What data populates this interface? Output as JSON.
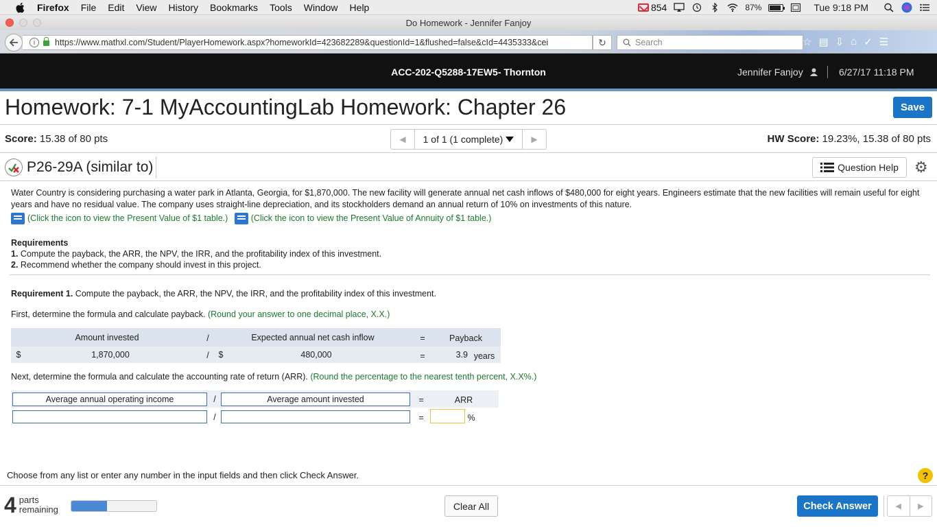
{
  "menubar": {
    "app": "Firefox",
    "items": [
      "File",
      "Edit",
      "View",
      "History",
      "Bookmarks",
      "Tools",
      "Window",
      "Help"
    ],
    "mail_count": "854",
    "battery": "87%",
    "clock": "Tue 9:18 PM"
  },
  "window": {
    "title": "Do Homework - Jennifer Fanjoy"
  },
  "browser": {
    "url": "https://www.mathxl.com/Student/PlayerHomework.aspx?homeworkId=423682289&questionId=1&flushed=false&cId=4435333&cei",
    "search_placeholder": "Search"
  },
  "course": {
    "name": "ACC-202-Q5288-17EW5- Thornton",
    "user": "Jennifer Fanjoy",
    "date": "6/27/17 11:18 PM"
  },
  "homework": {
    "title": "Homework: 7-1 MyAccountingLab Homework: Chapter 26",
    "save_label": "Save",
    "score_label": "Score:",
    "score_value": "15.38 of 80 pts",
    "pager_text": "1 of 1 (1 complete)",
    "hw_score_label": "HW Score:",
    "hw_score_value": "19.23%, 15.38 of 80 pts"
  },
  "question": {
    "title": "P26-29A (similar to)",
    "help_label": "Question Help",
    "problem_text": "Water Country is considering purchasing a water park in Atlanta, Georgia, for $1,870,000. The new facility will generate annual net cash inflows of $480,000 for eight years. Engineers estimate that the new facilities will remain useful for eight years and have no residual value. The company uses straight-line depreciation, and its stockholders demand an annual return of 10% on investments of this nature.",
    "link1": "(Click the icon to view the Present Value of $1 table.)",
    "link2": "(Click the icon to view the Present Value of Annuity of $1 table.)",
    "requirements_heading": "Requirements",
    "req1_num": "1.",
    "req1_text": "Compute the payback, the ARR, the NPV, the IRR, and the profitability index of this investment.",
    "req2_num": "2.",
    "req2_text": "Recommend whether the company should invest in this project.",
    "req1_heading": "Requirement 1.",
    "req1_heading_text": "Compute the payback, the ARR, the NPV, the IRR, and the profitability index of this investment.",
    "first_text": "First, determine the formula and calculate payback.",
    "first_hint": "(Round your answer to one decimal place, X.X.)",
    "next_text": "Next, determine the formula and calculate the accounting rate of return (ARR).",
    "next_hint": "(Round the percentage to the nearest tenth percent, X.X%.)"
  },
  "payback": {
    "h_amount": "Amount invested",
    "h_div": "/",
    "h_cash": "Expected annual net cash inflow",
    "h_eq": "=",
    "h_payback": "Payback",
    "dollar1": "$",
    "amount": "1,870,000",
    "div": "/",
    "dollar2": "$",
    "cash": "480,000",
    "eq": "=",
    "payback_value": "3.9",
    "unit": "years"
  },
  "arr": {
    "h_income": "Average annual operating income",
    "h_div": "/",
    "h_invested": "Average amount invested",
    "h_eq": "=",
    "h_arr": "ARR",
    "income_value": "",
    "div": "/",
    "invested_value": "",
    "eq": "=",
    "arr_value": "",
    "unit": "%"
  },
  "footer": {
    "instruction": "Choose from any list or enter any number in the input fields and then click Check Answer.",
    "help_glyph": "?",
    "parts_count": "4",
    "parts_label1": "parts",
    "parts_label2": "remaining",
    "progress_fraction": 0.42,
    "clear_label": "Clear All",
    "check_label": "Check Answer"
  },
  "colors": {
    "accent": "#1a75c9",
    "hint_green": "#1b7a2e",
    "header_bg": "#111111",
    "stripe": "#6899c6"
  }
}
